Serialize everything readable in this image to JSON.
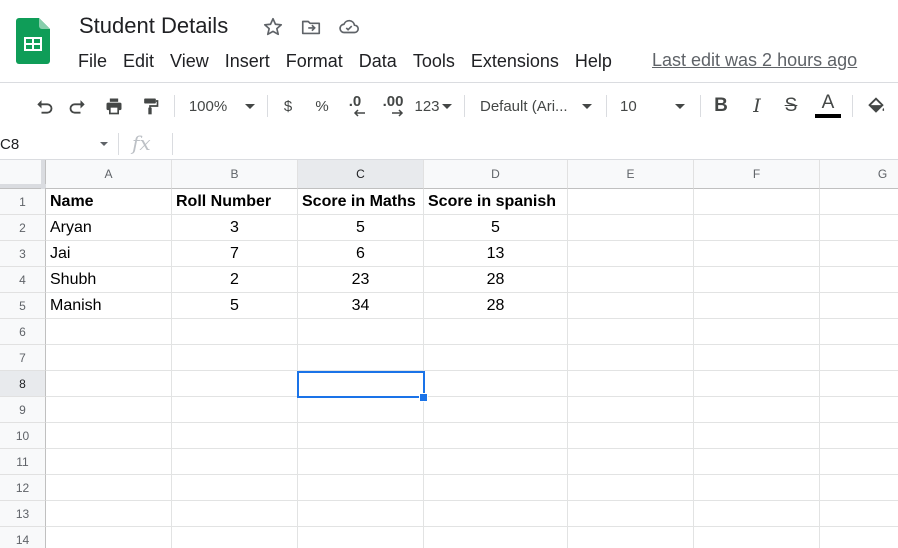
{
  "document": {
    "title": "Student Details"
  },
  "header_icons": [
    "star-icon",
    "move-to-folder-icon",
    "cloud-saved-icon"
  ],
  "menu": [
    "File",
    "Edit",
    "View",
    "Insert",
    "Format",
    "Data",
    "Tools",
    "Extensions",
    "Help"
  ],
  "last_edit": "Last edit was 2 hours ago",
  "toolbar": {
    "zoom": "100%",
    "currency": "$",
    "percent": "%",
    "decrease_decimals": ".0",
    "increase_decimals": ".00",
    "more_formats": "123",
    "font_family": "Default (Ari...",
    "font_size": "10",
    "bold": "B",
    "italic": "I",
    "strikethrough": "S",
    "text_color": "A",
    "text_color_value": "#000000"
  },
  "formula_bar": {
    "cell_ref": "C8",
    "fx": "fx",
    "value": ""
  },
  "grid": {
    "columns": [
      "A",
      "B",
      "C",
      "D",
      "E",
      "F",
      "G"
    ],
    "rows": [
      "1",
      "2",
      "3",
      "4",
      "5",
      "6",
      "7",
      "8",
      "9",
      "10",
      "11",
      "12",
      "13",
      "14"
    ],
    "selected_cell": "C8",
    "cells": [
      [
        "Name",
        "Roll Number",
        "Score in Maths",
        "Score in spanish"
      ],
      [
        "Aryan",
        "3",
        "5",
        "5"
      ],
      [
        "Jai",
        "7",
        "6",
        "13"
      ],
      [
        "Shubh",
        "2",
        "23",
        "28"
      ],
      [
        "Manish",
        "5",
        "34",
        "28"
      ]
    ]
  },
  "colors": {
    "accent": "#1a73e8",
    "sheets_green": "#0f9d58"
  }
}
